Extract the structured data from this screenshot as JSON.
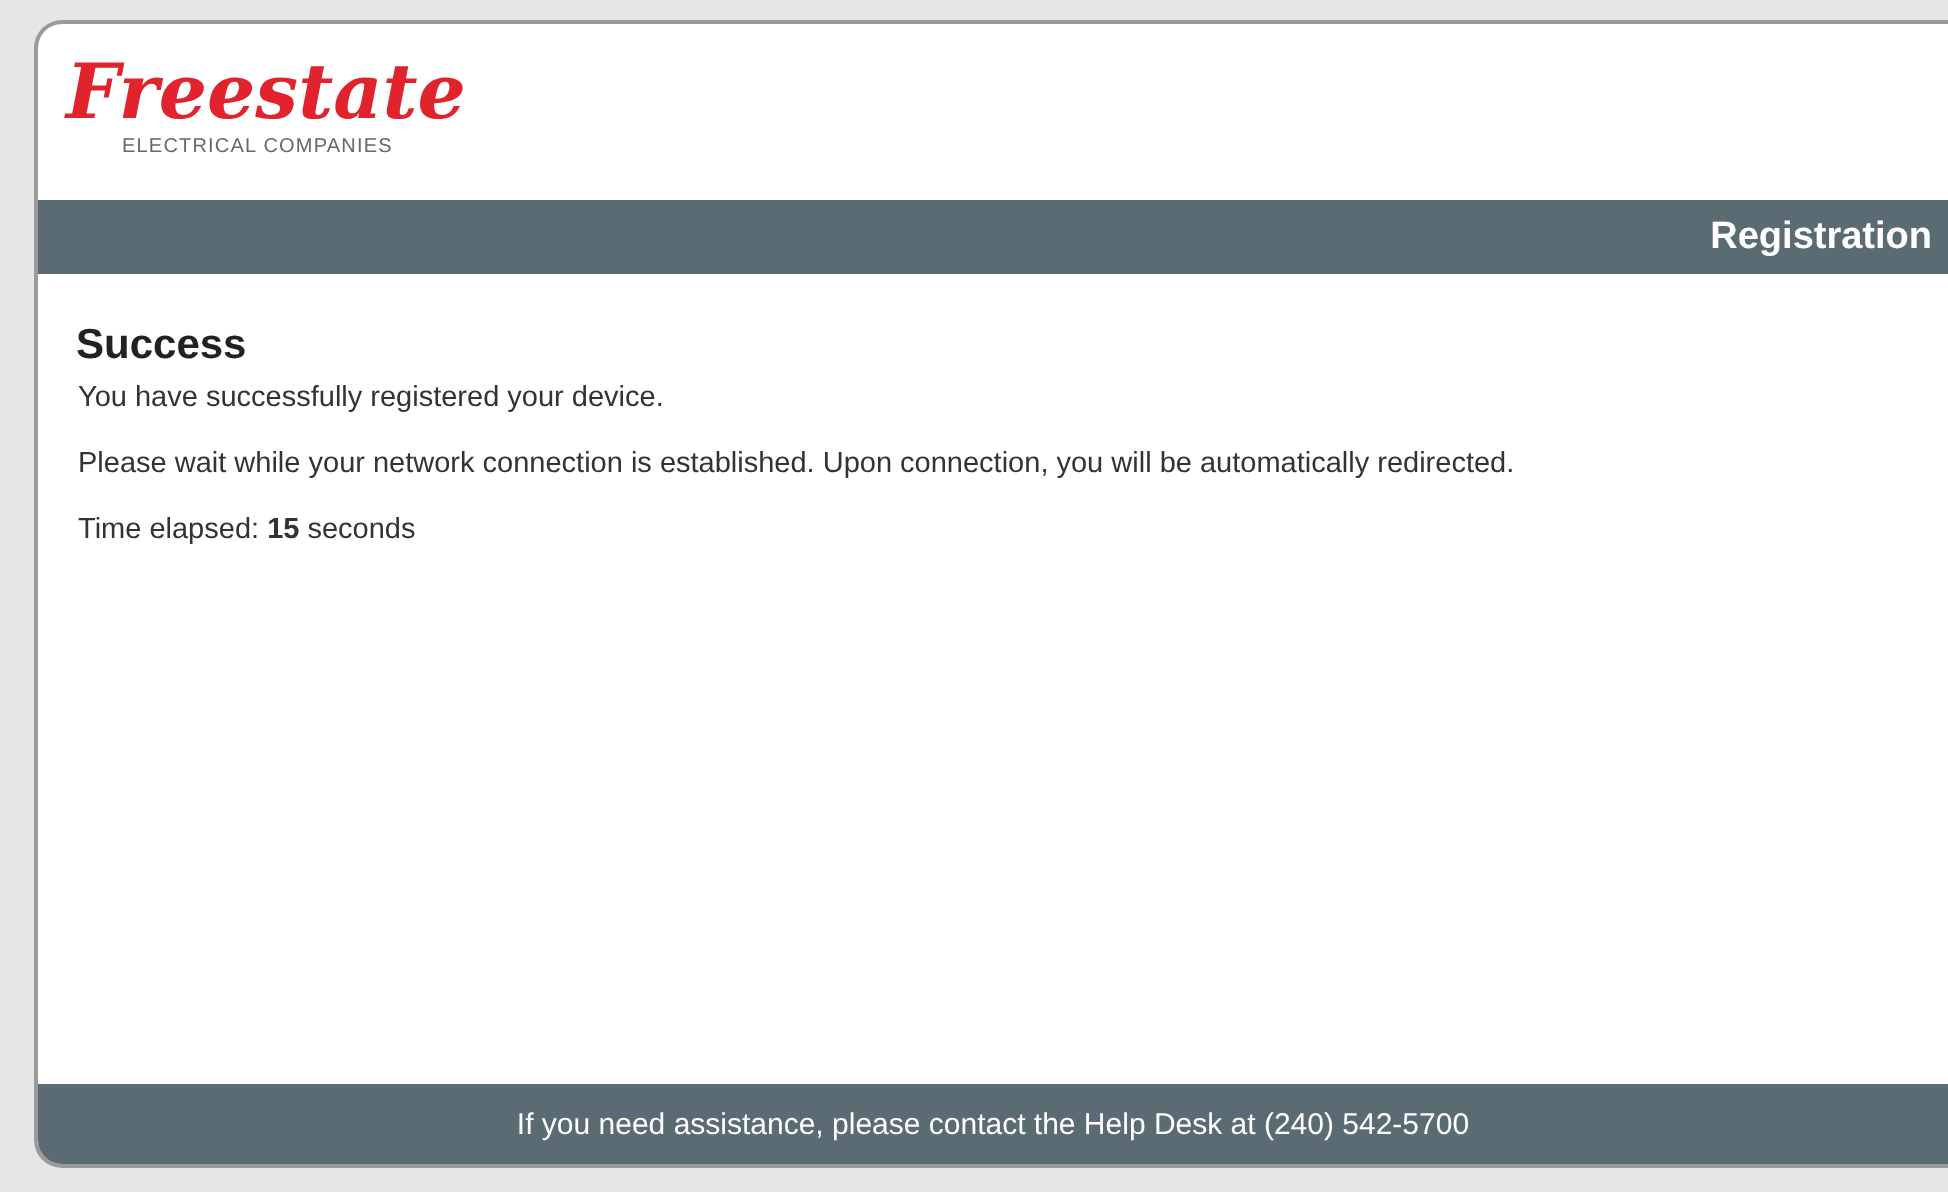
{
  "logo": {
    "name": "Freestate",
    "tagline": "ELECTRICAL COMPANIES"
  },
  "header_bar": {
    "title": "Registration"
  },
  "content": {
    "heading": "Success",
    "paragraphs": [
      "You have successfully registered your device.",
      "Please wait while your network connection is established. Upon connection, you will be automatically redirected.",
      "Time elapsed: **15** seconds"
    ]
  },
  "footer": {
    "text": "If you need assistance, please contact the Help Desk at (240) 542-5700"
  }
}
